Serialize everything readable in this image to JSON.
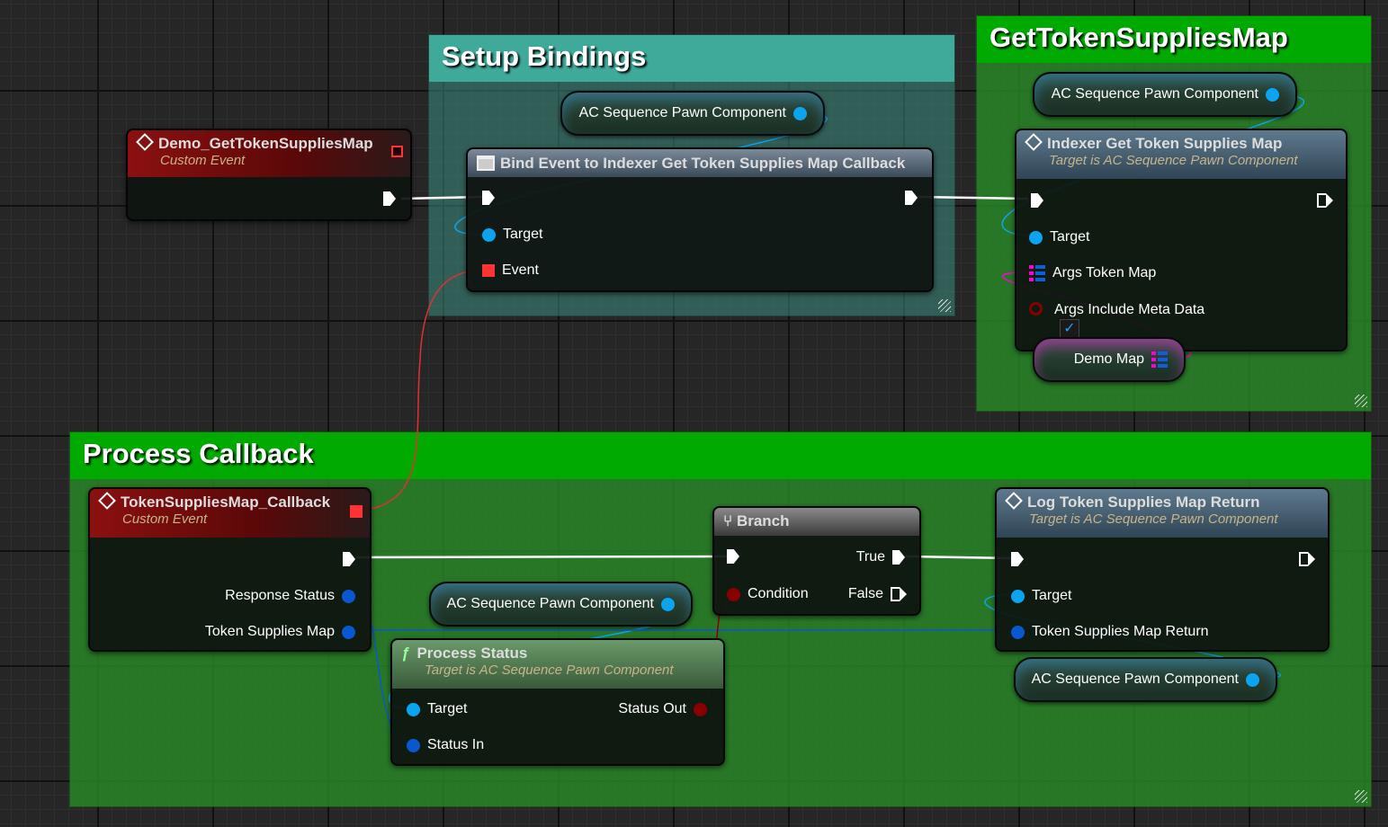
{
  "comments": {
    "setup": "Setup Bindings",
    "get": "GetTokenSuppliesMap",
    "process": "Process Callback"
  },
  "colors": {
    "setup_header": "#3fa99a",
    "get_header": "#00aa00",
    "exec_wire": "#ffffff",
    "object_wire": "#0ba4f0",
    "map_wire": "#ff00d8",
    "bool_wire": "#8a0000",
    "event_wire": "#e03030"
  },
  "nodes": {
    "demo_event": {
      "title": "Demo_GetTokenSuppliesMap",
      "subtitle": "Custom Event",
      "icon": "event-diamond-icon"
    },
    "bind_event": {
      "title": "Bind Event to Indexer Get Token Supplies Map Callback",
      "pins": {
        "target": "Target",
        "event": "Event"
      }
    },
    "indexer": {
      "title": "Indexer Get Token Supplies Map",
      "subtitle": "Target is AC Sequence Pawn Component",
      "pins": {
        "target": "Target",
        "args_token_map": "Args Token Map",
        "args_include_meta": "Args Include Meta Data"
      },
      "include_meta_checked": true
    },
    "callback": {
      "title": "TokenSuppliesMap_Callback",
      "subtitle": "Custom Event",
      "pins": {
        "response_status": "Response Status",
        "token_supplies_map": "Token Supplies Map"
      }
    },
    "branch": {
      "title": "Branch",
      "pins": {
        "true": "True",
        "false": "False",
        "condition": "Condition"
      }
    },
    "log": {
      "title": "Log Token Supplies Map Return",
      "subtitle": "Target is AC Sequence Pawn Component",
      "pins": {
        "target": "Target",
        "return": "Token Supplies Map Return"
      }
    },
    "process_status": {
      "title": "Process Status",
      "subtitle": "Target is AC Sequence Pawn Component",
      "pins": {
        "target": "Target",
        "status_out": "Status Out",
        "status_in": "Status In"
      }
    }
  },
  "variables": {
    "ac_component": "AC Sequence Pawn Component",
    "demo_map": "Demo Map"
  }
}
